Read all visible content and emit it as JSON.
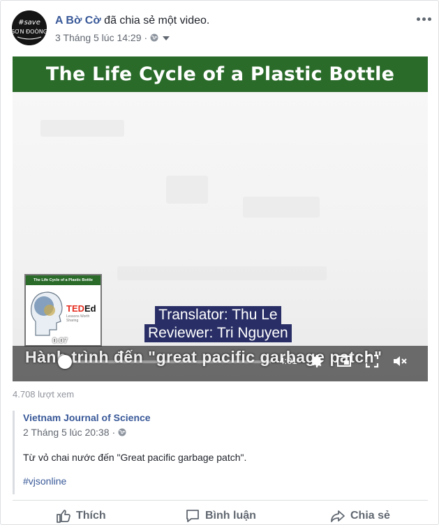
{
  "post": {
    "author": "A Bờ Cờ",
    "action_text": "đã chia sẻ một video.",
    "timestamp": "3 Tháng 5 lúc 14:29",
    "separator": "·",
    "privacy_icon": "globe-icon",
    "menu_icon": "more-horizontal-icon"
  },
  "video": {
    "title_banner": "The Life Cycle of a Plastic Bottle",
    "thumb_title": "The Life Cycle of a Plastic Bottle",
    "thumb_brand_ted": "TED",
    "thumb_brand_ed": "Ed",
    "thumb_subtitle": "Lessons Worth Sharing",
    "thumb_time": "0:07",
    "subtitle_line1": "Translator: Thu Le",
    "subtitle_line2": "Reviewer: Tri Nguyen",
    "hard_subtitle": "Hành trình đến \"great pacific garbage patch\"",
    "time_remaining": "-4:01",
    "progress_fraction": 0.03,
    "accent_color": "#4267b2",
    "banner_color": "#2a6b2a"
  },
  "views": "4.708 lượt xem",
  "shared": {
    "source_name": "Vietnam Journal of Science",
    "timestamp": "2 Tháng 5 lúc 20:38",
    "separator": "·",
    "text": "Từ vỏ chai nước đến \"Great pacific garbage patch\".",
    "hashtag": "#vjsonline"
  },
  "actions": {
    "like": "Thích",
    "comment": "Bình luận",
    "share": "Chia sẻ"
  }
}
